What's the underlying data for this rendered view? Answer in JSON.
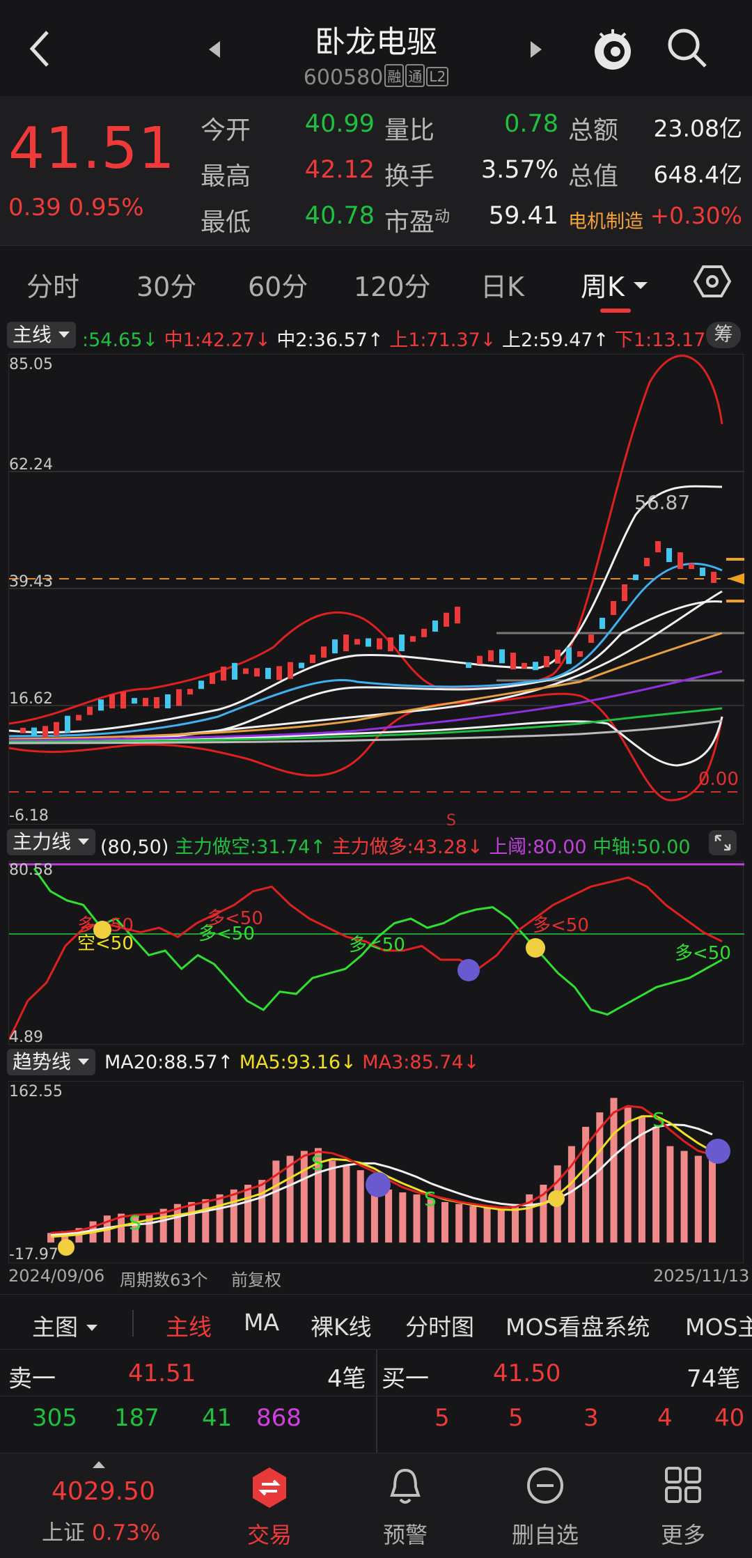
{
  "header": {
    "stock_name": "卧龙电驱",
    "stock_code": "600580",
    "tags": [
      "融",
      "通",
      "L2"
    ],
    "icons": [
      "back-chevron-icon",
      "prev-arrow-icon",
      "next-arrow-icon",
      "mascot-icon",
      "search-icon"
    ]
  },
  "quote": {
    "price": "41.51",
    "change": "0.39",
    "change_pct": "0.95%",
    "rows": [
      {
        "l1": "今开",
        "v1": "40.99",
        "l2": "量比",
        "v2": "0.78",
        "l3": "总额",
        "v3": "23.08亿"
      },
      {
        "l1": "最高",
        "v1": "42.12",
        "l2": "换手",
        "v2": "3.57%",
        "l3": "总值",
        "v3": "648.4亿"
      },
      {
        "l1": "最低",
        "v1": "40.78",
        "l2": "市盈",
        "v2": "59.41",
        "l3": "电机制造",
        "v3": "+0.30%"
      }
    ],
    "pe_sup": "动"
  },
  "tabs": {
    "items": [
      "分时",
      "30分",
      "60分",
      "120分",
      "日K",
      "周K"
    ],
    "active": "周K",
    "settings_icon": "hexagon-settings-icon"
  },
  "main_indicator": {
    "button": "主线",
    "values": [
      {
        "text": ":54.65↓",
        "color": "#1fbf3f"
      },
      {
        "text": "中1:42.27↓",
        "color": "#f03a3a"
      },
      {
        "text": "中2:36.57↑",
        "color": "#f0f0f0"
      },
      {
        "text": "上1:71.37↓",
        "color": "#f03a3a"
      },
      {
        "text": "上2:59.47↑",
        "color": "#f0f0f0"
      },
      {
        "text": "下1:13.17↑",
        "color": "#f03a3a"
      }
    ],
    "chip_btn": "筹",
    "yaxis": [
      "85.05",
      "62.24",
      "39.43",
      "16.62",
      "-6.18"
    ],
    "annotations": {
      "peak_label": "56.87",
      "zero_label": "0.00",
      "s_label": "S"
    }
  },
  "power_indicator": {
    "button": "主力线",
    "params": "(80,50)",
    "values": [
      {
        "text": "主力做空:31.74↑",
        "color": "#1fbf3f"
      },
      {
        "text": "主力做多:43.28↓",
        "color": "#f03a3a"
      },
      {
        "text": "上阈:80.00",
        "color": "#c040e0"
      },
      {
        "text": "中轴:50.00",
        "color": "#1fbf3f"
      }
    ],
    "yaxis": [
      "80.58",
      "4.89"
    ],
    "labels": [
      "多<50",
      "空<50",
      "多<50",
      "多<50",
      "多<50",
      "多<50",
      "多<50"
    ]
  },
  "trend_indicator": {
    "button": "趋势线",
    "values": [
      {
        "text": "MA20:88.57↑",
        "color": "#f0f0f0"
      },
      {
        "text": "MA5:93.16↓",
        "color": "#f0e020"
      },
      {
        "text": "MA3:85.74↓",
        "color": "#f03a3a"
      }
    ],
    "yaxis": [
      "162.55",
      "-17.97"
    ]
  },
  "chart_info": {
    "start_date": "2024/09/06",
    "period_count": "周期数63个",
    "adjust": "前复权",
    "end_date": "2025/11/13"
  },
  "menu": {
    "main_label": "主图",
    "items": [
      "主线",
      "MA",
      "裸K线",
      "分时图",
      "MOS看盘系统",
      "MOS主"
    ],
    "active": "主线"
  },
  "orderbook": {
    "sell_label": "卖一",
    "sell_price": "41.51",
    "sell_count": "4笔",
    "buy_label": "买一",
    "buy_price": "41.50",
    "buy_count": "74笔",
    "sell_detail": [
      "305",
      "187",
      "41",
      "868"
    ],
    "buy_detail": [
      "5",
      "5",
      "3",
      "4",
      "40"
    ]
  },
  "bottom_nav": {
    "index_value": "4029.50",
    "index_name": "上证",
    "index_pct": "0.73%",
    "items": [
      {
        "label": "交易",
        "icon": "trade-icon"
      },
      {
        "label": "预警",
        "icon": "bell-icon"
      },
      {
        "label": "删自选",
        "icon": "remove-circle-icon"
      },
      {
        "label": "更多",
        "icon": "grid-more-icon"
      }
    ]
  },
  "chart_data": [
    {
      "type": "line",
      "title": "主线",
      "x": [
        1,
        2,
        3,
        4,
        5,
        6,
        7,
        8,
        9,
        10,
        11,
        12,
        13,
        14,
        15,
        16,
        17,
        18,
        19,
        20,
        21,
        22,
        23,
        24,
        25,
        26,
        27,
        28,
        29,
        30,
        31,
        32,
        33,
        34,
        35,
        36,
        37,
        38,
        39,
        40,
        41,
        42,
        43,
        44,
        45,
        46,
        47,
        48,
        49,
        50,
        51,
        52,
        53,
        54,
        55,
        56,
        57,
        58,
        59,
        60,
        61,
        62,
        63
      ],
      "series": [
        {
          "name": "上1",
          "values": [
            14,
            13,
            12,
            13,
            14,
            14,
            16,
            17,
            18,
            20,
            22,
            24,
            26,
            28,
            30,
            32,
            36,
            40,
            44,
            47,
            49,
            48,
            45,
            40,
            34,
            28,
            24,
            21,
            20,
            19,
            19,
            20,
            21,
            23,
            27,
            35,
            50,
            70,
            85,
            86,
            84,
            78
          ]
        },
        {
          "name": "下1",
          "values": [
            9,
            8,
            7,
            6,
            5,
            4,
            4,
            4,
            5,
            6,
            7,
            8,
            8,
            8,
            7,
            5,
            3,
            2,
            2,
            3,
            5,
            8,
            11,
            13,
            14,
            14,
            14,
            13,
            12,
            10,
            6,
            0,
            -5,
            -8,
            -6,
            2,
            13
          ]
        }
      ],
      "ylim": [
        -6.18,
        85.05
      ]
    },
    {
      "type": "line",
      "title": "主力线",
      "series": [
        {
          "name": "主力做空",
          "values": [
            80,
            70,
            66,
            64,
            55,
            58,
            50,
            42,
            44,
            36,
            42,
            38,
            30,
            22,
            18,
            26,
            25,
            32,
            34,
            36,
            42,
            50,
            56,
            58,
            54,
            56,
            60,
            62,
            63,
            58,
            50,
            42,
            34,
            28,
            18,
            16,
            20,
            24,
            28,
            30,
            32,
            36,
            40
          ]
        },
        {
          "name": "主力做多",
          "values": [
            5,
            22,
            30,
            46,
            54,
            56,
            54,
            52,
            54,
            50,
            56,
            60,
            64,
            70,
            72,
            64,
            58,
            54,
            50,
            48,
            44,
            44,
            46,
            40,
            40,
            36,
            42,
            52,
            58,
            64,
            68,
            72,
            74,
            76,
            72,
            64,
            58,
            52,
            48
          ]
        }
      ],
      "ylim": [
        4.89,
        80.58
      ]
    },
    {
      "type": "bar",
      "title": "趋势线",
      "values": [
        10,
        12,
        15,
        22,
        28,
        30,
        28,
        30,
        35,
        40,
        42,
        45,
        50,
        55,
        60,
        65,
        85,
        90,
        95,
        98,
        85,
        80,
        75,
        65,
        55,
        52,
        50,
        45,
        42,
        40,
        38,
        36,
        35,
        40,
        50,
        60,
        80,
        100,
        120,
        135,
        150,
        140,
        130,
        120,
        100,
        95,
        90,
        88
      ],
      "ylim": [
        -17.97,
        162.55
      ]
    }
  ]
}
